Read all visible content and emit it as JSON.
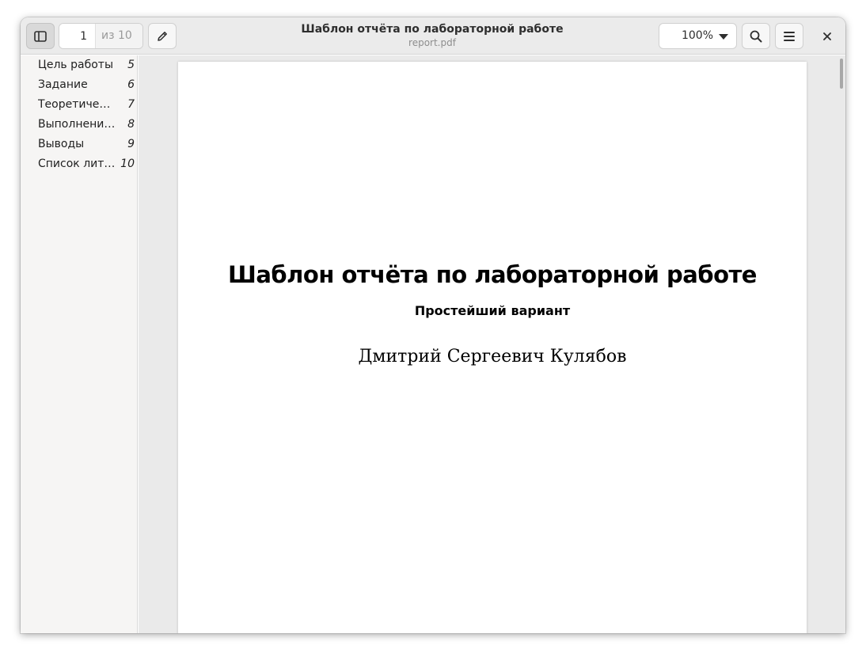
{
  "header": {
    "title": "Шаблон отчёта по лабораторной работе",
    "subtitle": "report.pdf",
    "page_current": "1",
    "page_total": "из 10",
    "zoom": "100%",
    "icons": {
      "sidebar_toggle": "sidebar-icon",
      "annotate": "pencil-icon",
      "search": "search-icon",
      "menu": "menu-icon",
      "close": "close-icon",
      "zoom_dropdown": "chevron-down-icon"
    }
  },
  "sidebar": {
    "outline": [
      {
        "label": "Цель работы",
        "page": "5"
      },
      {
        "label": "Задание",
        "page": "6"
      },
      {
        "label": "Теоретическое введение",
        "page": "7"
      },
      {
        "label": "Выполнение лабораторной работы",
        "page": "8"
      },
      {
        "label": "Выводы",
        "page": "9"
      },
      {
        "label": "Список литературы",
        "page": "10"
      }
    ],
    "tabs": [
      {
        "name": "thumbnails",
        "icon": "grid-icon",
        "active": false
      },
      {
        "name": "outline",
        "icon": "outline-icon",
        "active": true
      },
      {
        "name": "annotations",
        "icon": "annotations-icon",
        "active": false
      },
      {
        "name": "bookmarks",
        "icon": "bookmark-icon",
        "active": false
      }
    ]
  },
  "document": {
    "title": "Шаблон отчёта по лабораторной работе",
    "subtitle": "Простейший вариант",
    "author": "Дмитрий Сергеевич Кулябов"
  },
  "colors": {
    "headerbar": "#ebebeb",
    "sidebar": "#f6f5f4",
    "canvas": "#eaeaea",
    "active_button": "#d9d9d9"
  }
}
